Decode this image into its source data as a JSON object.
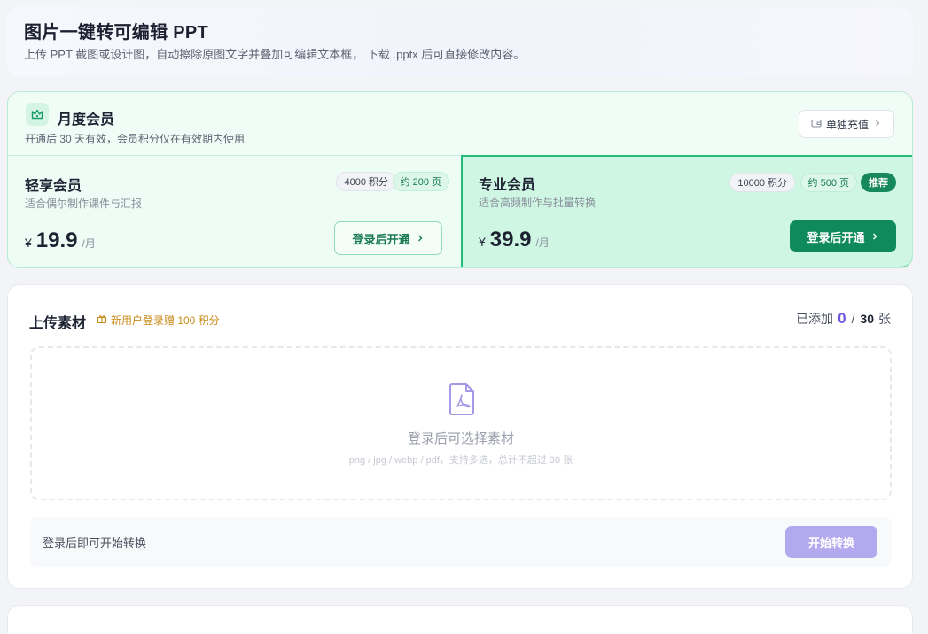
{
  "header": {
    "title": "图片一键转可编辑 PPT",
    "subtitle": "上传 PPT 截图或设计图，自动擦除原图文字并叠加可编辑文本框， 下载 .pptx 后可直接修改内容。"
  },
  "membership": {
    "icon": "crown-icon",
    "title": "月度会员",
    "description": "开通后 30 天有效，会员积分仅在有效期内使用",
    "recharge_button": "单独充值",
    "plans": [
      {
        "name": "轻享会员",
        "description": "适合偶尔制作课件与汇报",
        "points": "4000 积分",
        "pages": "约 200 页",
        "currency": "¥",
        "price": "19.9",
        "unit": "/月",
        "button": "登录后开通"
      },
      {
        "name": "专业会员",
        "description": "适合高频制作与批量转换",
        "points": "10000 积分",
        "pages": "约 500 页",
        "badge": "推荐",
        "currency": "¥",
        "price": "39.9",
        "unit": "/月",
        "button": "登录后开通"
      }
    ]
  },
  "upload": {
    "title": "上传素材",
    "gift_text": "新用户登录赠 100 积分",
    "counter_label": "已添加",
    "count": "0",
    "separator": "/",
    "total": "30",
    "counter_unit": "张",
    "dropzone_title": "登录后可选择素材",
    "dropzone_hint": "png / jpg / webp / pdf，支持多选，总计不超过 30 张",
    "action_hint": "登录后即可开始转换",
    "start_button": "开始转换"
  },
  "colors": {
    "accent_green": "#0f8a5c",
    "accent_purple": "#6b5ae0",
    "disabled_purple": "#b3a9ee",
    "gift_orange": "#c98a17"
  }
}
